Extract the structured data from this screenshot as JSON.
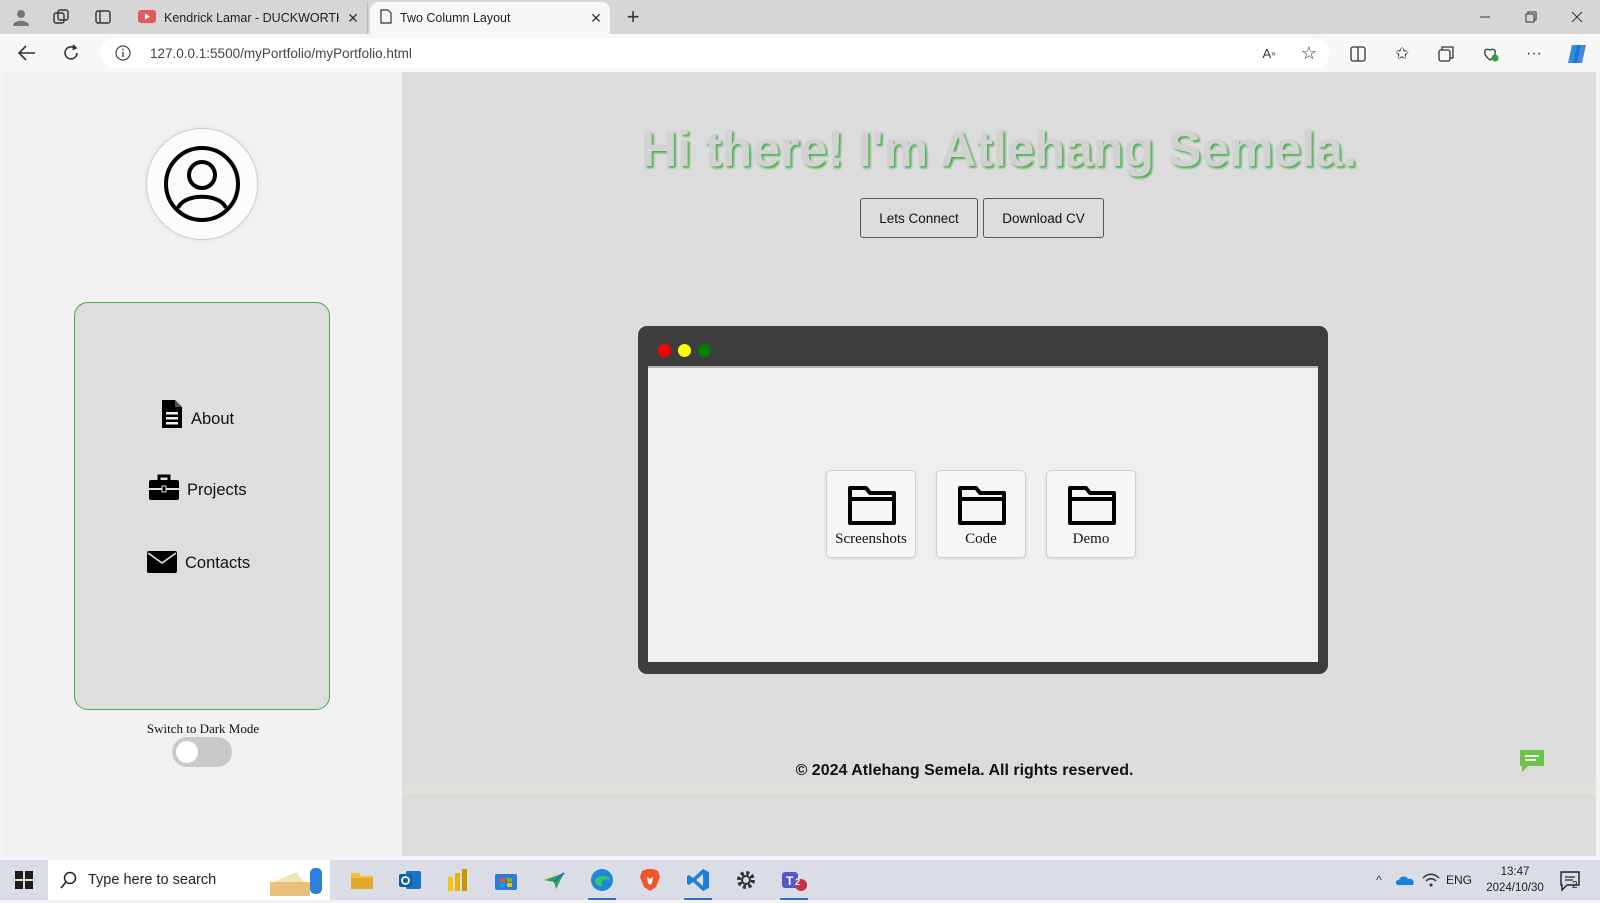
{
  "browser": {
    "tabs": [
      {
        "label": "Kendrick Lamar - DUCKWORTH. t",
        "active": false
      },
      {
        "label": "Two Column Layout",
        "active": true
      }
    ],
    "url": "127.0.0.1:5500/myPortfolio/myPortfolio.html"
  },
  "sidebar": {
    "nav": [
      {
        "label": "About",
        "icon": "file-icon"
      },
      {
        "label": "Projects",
        "icon": "briefcase-icon"
      },
      {
        "label": "Contacts",
        "icon": "envelope-icon"
      }
    ],
    "dark_mode_label": "Switch to Dark Mode",
    "dark_mode_on": false
  },
  "main": {
    "title": "Hi there! I'm Atlehang Semela.",
    "buttons": {
      "connect": "Lets Connect",
      "cv": "Download CV"
    },
    "window": {
      "dots": [
        "#ff0000",
        "#ffff00",
        "#008000"
      ],
      "folders": [
        {
          "label": "Screenshots"
        },
        {
          "label": "Code"
        },
        {
          "label": "Demo"
        }
      ]
    },
    "footer": "© 2024 Atlehang Semela. All rights reserved."
  },
  "taskbar": {
    "search_placeholder": "Type here to search",
    "language": "ENG",
    "time": "13:47",
    "date": "2024/10/30",
    "notifications": "2",
    "teams_badge": "2"
  },
  "colors": {
    "accent_green": "#3cb043",
    "title_shadow": "#4cae4c",
    "chat_fab": "#6cc24a"
  }
}
